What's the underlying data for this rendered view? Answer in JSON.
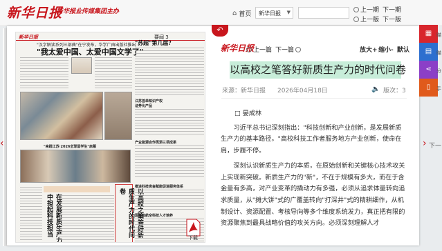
{
  "header": {
    "logo": "新华日报",
    "slogan": "新华报业传媒集团主办",
    "home_label": "首页",
    "paper_select": "新华日报",
    "nav": {
      "up_period": "上一期",
      "up_edition": "上一版",
      "next_period": "下一期",
      "next_edition": "下一版"
    }
  },
  "sides": {
    "next_label": "下一"
  },
  "newspaper": {
    "masthead": "新华日报",
    "edition": "要闻 3",
    "kicker1": "\"汉字解读系列三部曲\"在宁发布，华学广由出版社推出",
    "headline": "\"我太爱中国、太爱中国文学了\"",
    "headline2": "\"苏超\"第几届？",
    "mini1": "江苏首单知识产权",
    "mini2": "证券化产品",
    "mini3": "\"来践江苏·2026全球留学生\"启幕",
    "mini4": "产业能源合作再添三项成果",
    "mini5": "推进科技资金赋能促进服务体系",
    "mini6": "国家级航空科技人才培养",
    "vheadline1": "在发展新质生产力中担起科技担当",
    "vheadline2": "以高校之笔答好新质生产力的时代问卷",
    "download_label": "下载"
  },
  "article": {
    "logo": "新华日报",
    "prev_label": "上一篇",
    "next_label": "下一篇",
    "zoom_in": "放大+",
    "zoom_out": "缩小-",
    "zoom_default": "默认",
    "title": "以高校之笔答好新质生产力的时代问卷",
    "source": "来源：新华日报",
    "date": "2026年04月18日",
    "edition": "版次：3",
    "author": "□ 晏成林",
    "paragraphs": [
      "习近平总书记深刻指出：\"科技创新和产业创新，是发展新质生产力的基本路径。\"高校科技工作者服务地方产业创新，使命在肩，步履不停。",
      "深刻认识新质生产力的本质，在原始创新和关键核心技术攻关上实现新突破。新质生产力的\"新\"，不在于规模有多大，而在于含金量有多高，对产业变革的撬动力有多强，必须从追求体量转向追求质量，从\"摊大饼\"式的广覆盖转向\"打深井\"式的精耕细作，从机制设计、资源配置、考核导向等多个维度系统发力，真正把有限的资源聚焦到最具战略价值的攻关方向。必须深刻理解人才"
    ]
  },
  "toolbar": {
    "items": [
      {
        "label": "瞄",
        "color": "#d8262d"
      },
      {
        "label": "瞄",
        "color": "#2d6fcf"
      },
      {
        "label": "分",
        "color": "#8b3fc7"
      },
      {
        "label": "手",
        "color": "#e05a1b"
      }
    ]
  }
}
